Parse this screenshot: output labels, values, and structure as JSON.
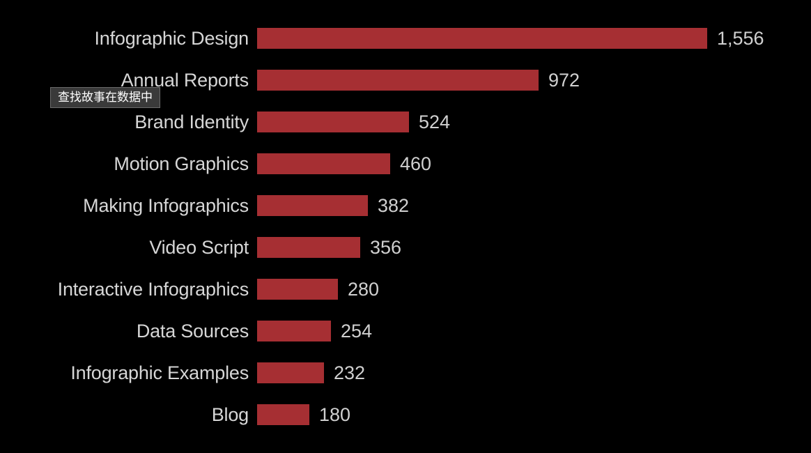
{
  "chart_data": {
    "type": "bar",
    "orientation": "horizontal",
    "title": "",
    "subtitle": "",
    "xlabel": "",
    "ylabel": "",
    "grid": false,
    "legend": false,
    "axis_visible": false,
    "xlim": [
      0,
      1556
    ],
    "categories": [
      "Infographic Design",
      "Annual Reports",
      "Brand Identity",
      "Motion Graphics",
      "Making Infographics",
      "Video Script",
      "Interactive Infographics",
      "Data Sources",
      "Infographic Examples",
      "Blog"
    ],
    "values": [
      1556,
      972,
      524,
      460,
      382,
      356,
      280,
      254,
      232,
      180
    ],
    "value_labels": [
      "1,556",
      "972",
      "524",
      "460",
      "382",
      "356",
      "280",
      "254",
      "232",
      "180"
    ],
    "bar_color": "#a62f33",
    "background_color": "#000000",
    "label_color": "#d6d6d6",
    "value_color": "#d0d0d0"
  },
  "tooltip": {
    "text": "查找故事在数据中",
    "background_color": "#3a3a3a",
    "border_color": "#6a6a6a",
    "text_color": "#ffffff"
  }
}
